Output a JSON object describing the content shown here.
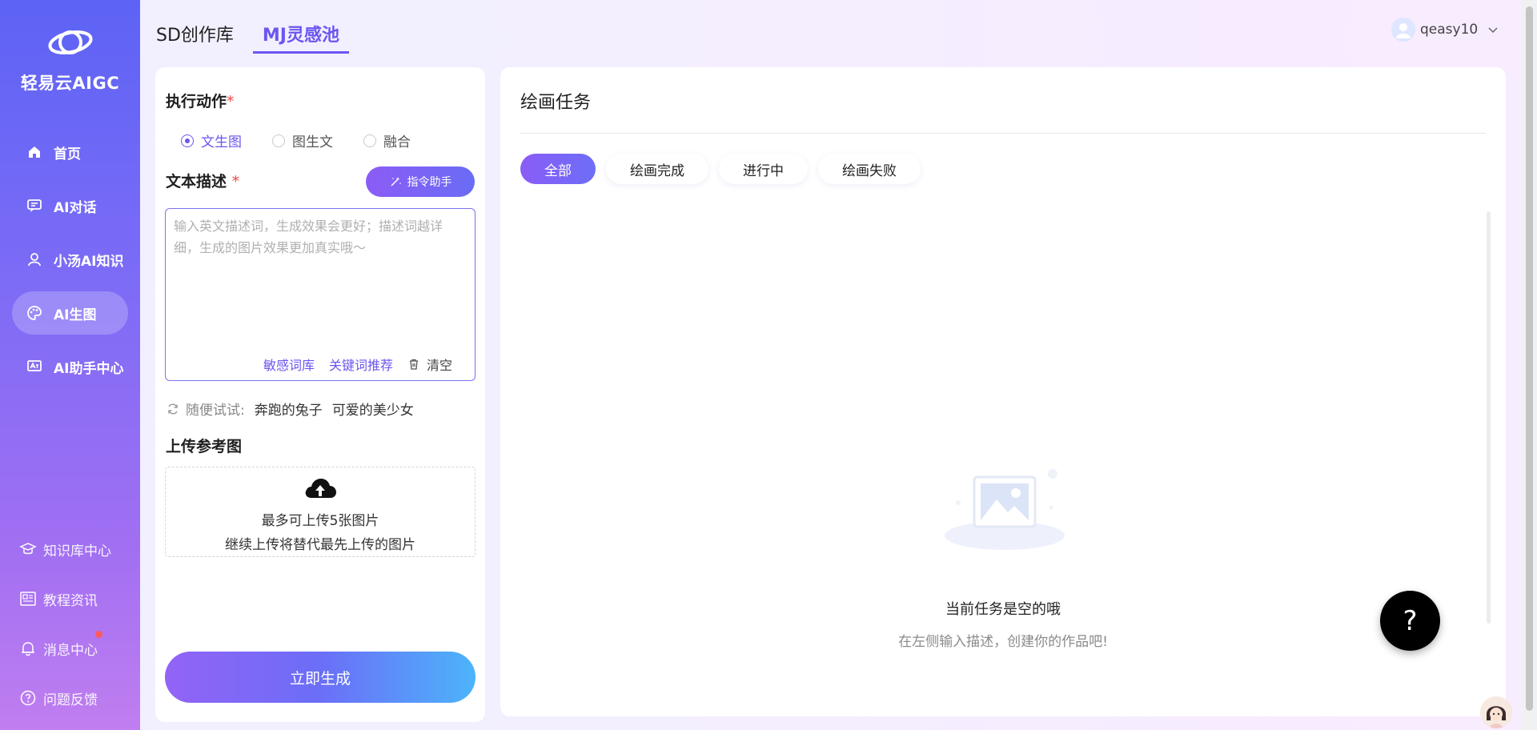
{
  "brand": {
    "name": "轻易云AIGC"
  },
  "sidebar": {
    "items": [
      {
        "label": "首页",
        "icon": "home-icon",
        "active": false
      },
      {
        "label": "AI对话",
        "icon": "chat-icon",
        "active": false
      },
      {
        "label": "小汤AI知识",
        "icon": "user-icon",
        "active": false
      },
      {
        "label": "AI生图",
        "icon": "palette-icon",
        "active": true
      },
      {
        "label": "AI助手中心",
        "icon": "assistant-icon",
        "active": false
      }
    ],
    "bottom": [
      {
        "label": "知识库中心",
        "icon": "graduation-cap-icon"
      },
      {
        "label": "教程资讯",
        "icon": "news-icon"
      },
      {
        "label": "消息中心",
        "icon": "bell-icon",
        "has_dot": true
      },
      {
        "label": "问题反馈",
        "icon": "question-circle-icon"
      }
    ]
  },
  "header": {
    "tabs": [
      {
        "label": "SD创作库",
        "active": false
      },
      {
        "label": "MJ灵感池",
        "active": true
      }
    ],
    "username": "qeasy10"
  },
  "left": {
    "action_label": "执行动作",
    "required_mark": "*",
    "modes": [
      {
        "label": "文生图",
        "checked": true
      },
      {
        "label": "图生文",
        "checked": false
      },
      {
        "label": "融合",
        "checked": false
      }
    ],
    "desc_label": "文本描述",
    "assist_label": "指令助手",
    "prompt_value": "",
    "prompt_placeholder": "输入英文描述词，生成效果会更好；描述词越详细，生成的图片效果更加真实哦～",
    "sensitive_label": "敏感词库",
    "keyword_label": "关键词推荐",
    "clear_label": "清空",
    "try_label": "随便试试:",
    "try_chips": [
      "奔跑的兔子",
      "可爱的美少女"
    ],
    "upload_label": "上传参考图",
    "upload_line1": "最多可上传5张图片",
    "upload_line2": "继续上传将替代最先上传的图片",
    "generate_label": "立即生成"
  },
  "right": {
    "title": "绘画任务",
    "filters": [
      {
        "label": "全部",
        "active": true
      },
      {
        "label": "绘画完成",
        "active": false
      },
      {
        "label": "进行中",
        "active": false
      },
      {
        "label": "绘画失败",
        "active": false
      }
    ],
    "empty_title": "当前任务是空的哦",
    "empty_subtitle": "在左侧输入描述，创建你的作品吧!"
  },
  "help_label": "?",
  "colors": {
    "accent": "#6a56f0",
    "sidebar_top": "#5d63f5",
    "sidebar_bottom": "#c07ef0"
  }
}
